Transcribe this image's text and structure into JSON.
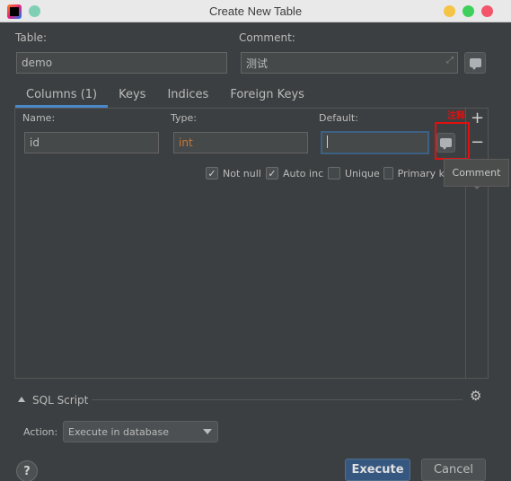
{
  "window": {
    "title": "Create New Table"
  },
  "table_field": {
    "label": "Table:",
    "value": "demo"
  },
  "comment_field": {
    "label": "Comment:",
    "value": "测试"
  },
  "tabs": [
    {
      "label": "Columns (1)",
      "active": true
    },
    {
      "label": "Keys",
      "active": false
    },
    {
      "label": "Indices",
      "active": false
    },
    {
      "label": "Foreign Keys",
      "active": false
    }
  ],
  "column": {
    "name_label": "Name:",
    "name_value": "id",
    "type_label": "Type:",
    "type_value": "int",
    "default_label": "Default:",
    "default_value": ""
  },
  "checkboxes": [
    {
      "label": "Not null",
      "checked": true
    },
    {
      "label": "Auto inc",
      "checked": true
    },
    {
      "label": "Unique",
      "checked": false
    },
    {
      "label": "Primary k",
      "checked": false
    }
  ],
  "tooltip": {
    "text": "Comment"
  },
  "annotation": {
    "text": "注释",
    "color": "#e01010"
  },
  "sql_script": {
    "label": "SQL Script"
  },
  "action": {
    "label": "Action:",
    "selected": "Execute in database"
  },
  "buttons": {
    "help": "?",
    "execute": "Execute",
    "cancel": "Cancel"
  },
  "colors": {
    "accent": "#4a88c7",
    "execute_bg": "#365880",
    "type_text": "#cc7832"
  }
}
